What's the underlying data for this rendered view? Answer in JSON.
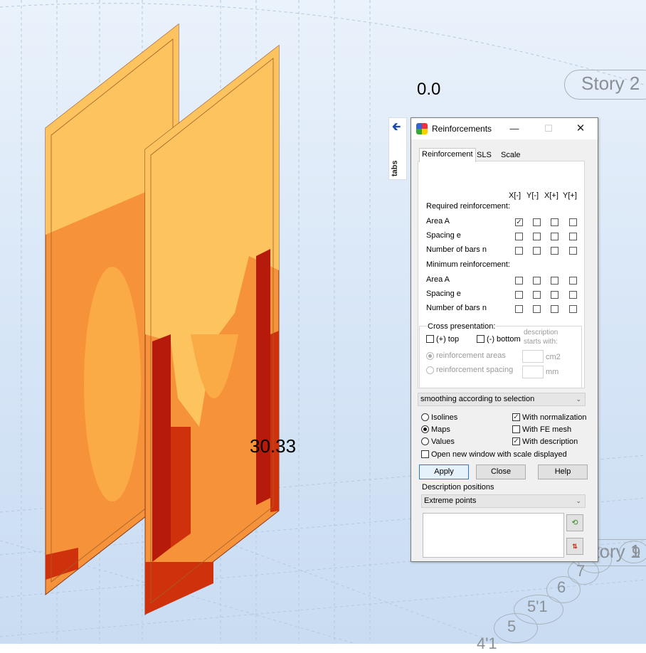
{
  "viewport": {
    "label_top": "0.0",
    "label_value": "30.33",
    "story_2": "Story 2",
    "story_1": "Story 1",
    "axis_labels": [
      "9",
      "8",
      "7",
      "6",
      "5'1",
      "5",
      "4'1"
    ]
  },
  "tabs_strip": {
    "label": "tabs"
  },
  "dialog": {
    "title": "Reinforcements",
    "tabs": [
      "Reinforcement",
      "SLS",
      "Scale"
    ],
    "column_headers": [
      "X[-]",
      "Y[-]",
      "X[+]",
      "Y[+]"
    ],
    "required_title": "Required reinforcement:",
    "required_rows": [
      {
        "label": "Area A",
        "checked": [
          true,
          false,
          false,
          false
        ]
      },
      {
        "label": "Spacing e",
        "checked": [
          false,
          false,
          false,
          false
        ]
      },
      {
        "label": "Number of bars n",
        "checked": [
          false,
          false,
          false,
          false
        ]
      }
    ],
    "minimum_title": "Minimum reinforcement:",
    "minimum_rows": [
      {
        "label": "Area A",
        "checked": [
          false,
          false,
          false,
          false
        ]
      },
      {
        "label": "Spacing e",
        "checked": [
          false,
          false,
          false,
          false
        ]
      },
      {
        "label": "Number of bars n",
        "checked": [
          false,
          false,
          false,
          false
        ]
      }
    ],
    "cross": {
      "title": "Cross presentation:",
      "top_label": "(+) top",
      "bottom_label": "(-) bottom",
      "desc_line1": "description",
      "desc_line2": "starts with:",
      "areas_label": "reinforcement areas",
      "spacing_label": "reinforcement spacing",
      "unit_area": "cm2",
      "unit_spacing": "mm"
    },
    "smoothing": "smoothing according to selection",
    "radios": {
      "isolines": "Isolines",
      "maps": "Maps",
      "values": "Values",
      "selected": "Maps"
    },
    "checks": {
      "with_normalization": "With normalization",
      "with_fe_mesh": "With FE mesh",
      "with_description": "With description",
      "open_new_window": "Open new window with scale displayed"
    },
    "buttons": {
      "apply": "Apply",
      "close": "Close",
      "help": "Help"
    },
    "desc_positions_title": "Description positions",
    "desc_positions_value": "Extreme points"
  }
}
